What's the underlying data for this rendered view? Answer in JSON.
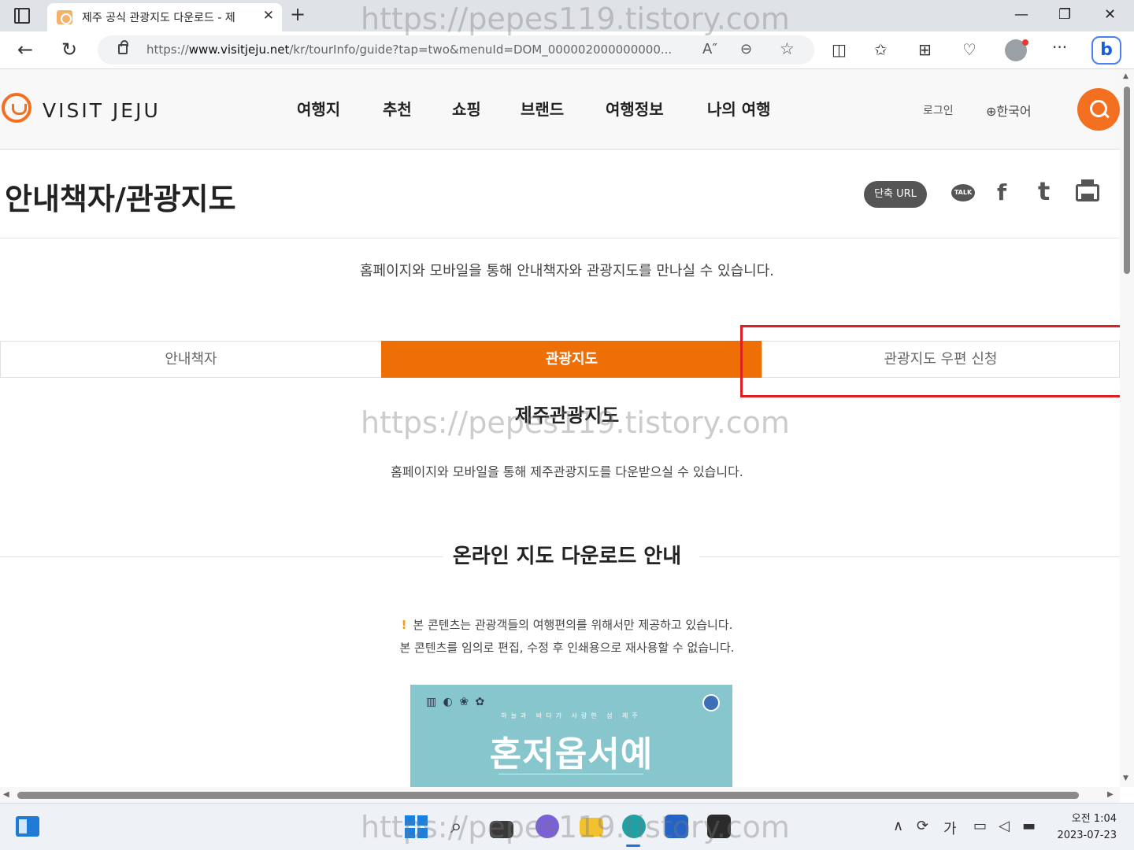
{
  "browser": {
    "tab_title": "제주 공식 관광지도 다운로드 - 제",
    "tab_close": "✕",
    "new_tab": "+",
    "window_minimize": "—",
    "window_restore": "❐",
    "window_close": "✕",
    "url_prefix": "https://",
    "url_host": "www.visitjeju.net",
    "url_path": "/kr/tourInfo/guide?tap=two&menuId=DOM_000002000000000...",
    "read_aloud": "A″",
    "back": "←",
    "refresh": "↻",
    "zoom": "⊖",
    "favorite": "☆",
    "split": "◫",
    "favorites_bar": "✩",
    "collections": "⊞",
    "health": "♡",
    "more": "···",
    "bing": "b"
  },
  "site": {
    "logo": "VISIT JEJU",
    "nav": [
      "여행지",
      "추천",
      "쇼핑",
      "브랜드",
      "여행정보",
      "나의 여행"
    ],
    "login": "로그인",
    "language": "한국어",
    "globe": "⊕"
  },
  "page": {
    "title": "안내책자/관광지도",
    "short_url": "단축 URL",
    "talk": "TALK",
    "facebook": "f",
    "twitter": "t",
    "intro": "홈페이지와 모바일을 통해 안내책자와 관광지도를 만나실 수 있습니다.",
    "tabs": [
      "안내책자",
      "관광지도",
      "관광지도 우편 신청"
    ],
    "active_tab": 1,
    "section_title": "제주관광지도",
    "section_desc": "홈페이지와 모바일을 통해 제주관광지도를 다운받으실 수 있습니다.",
    "online_title": "온라인 지도 다운로드 안내",
    "notice_mark": "!",
    "notice_1": "본 콘텐츠는 관광객들의 여행편의를 위해서만 제공하고 있습니다.",
    "notice_2": "본 콘텐츠를 임의로 편집, 수정 후 인쇄용으로 재사용할 수 없습니다.",
    "banner_sub": "하늘과 바다가 사랑한 섬 제주",
    "banner_title": "혼저옵서예"
  },
  "watermark": "https://pepes119.tistory.com",
  "taskbar": {
    "search": "⌕",
    "tray_chevron": "∧",
    "ime": "가",
    "time": "오전 1:04",
    "date": "2023-07-23"
  },
  "colors": {
    "accent": "#ee6f05",
    "highlight": "#e02020",
    "banner": "#86c6cc"
  }
}
